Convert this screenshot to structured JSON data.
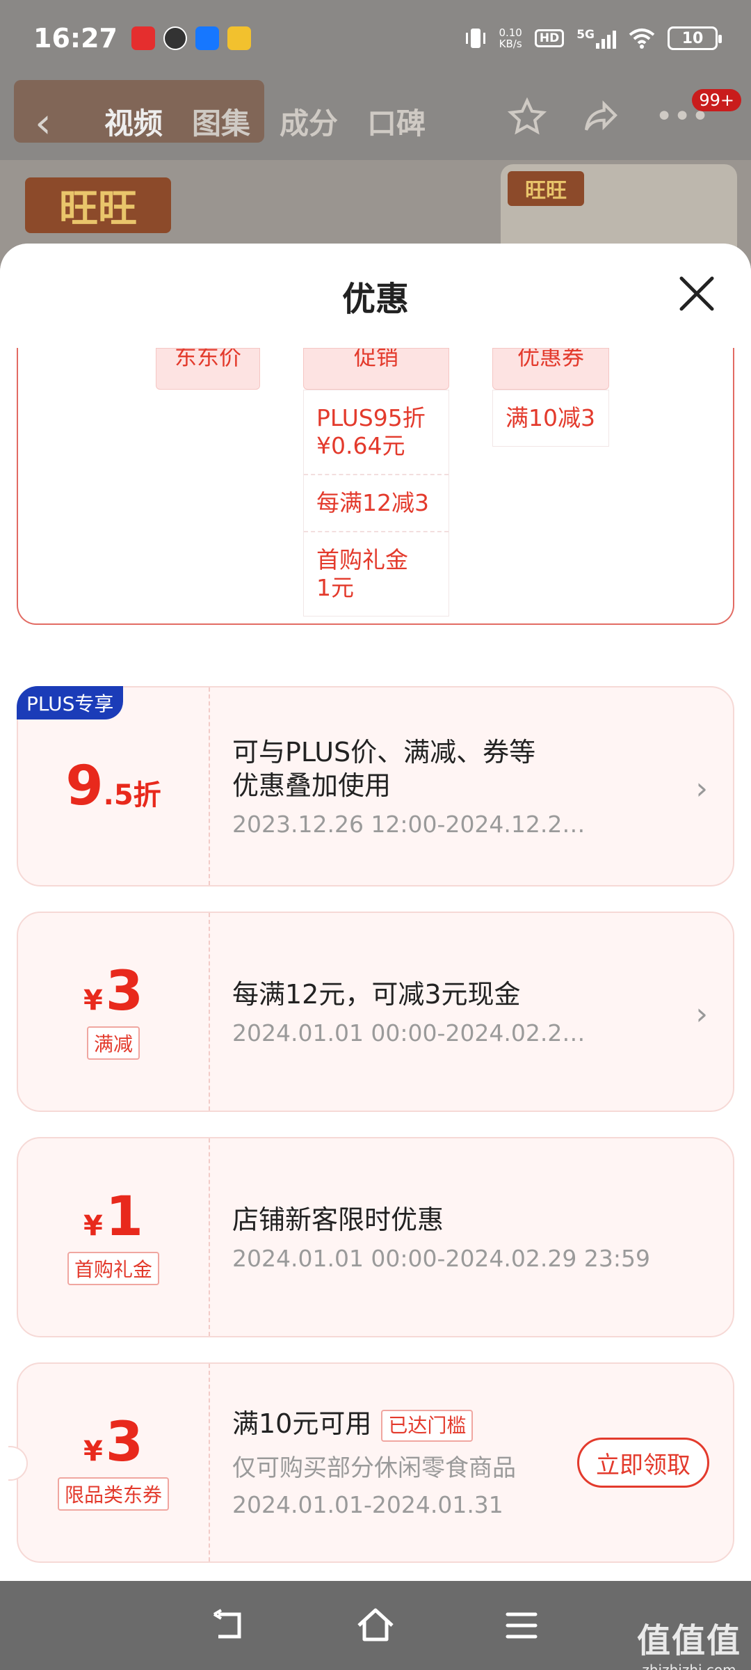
{
  "status_bar": {
    "time": "16:27",
    "net_speed_value": "0.10",
    "net_speed_unit": "KB/s",
    "hd": "HD",
    "network": "5G",
    "battery": "10"
  },
  "nav": {
    "tabs": [
      "视频",
      "图集",
      "成分",
      "口碑"
    ],
    "badge": "99+"
  },
  "background": {
    "brand_logo": "旺旺"
  },
  "sheet": {
    "title": "优惠",
    "summary": {
      "col1_head": "东东价",
      "col2_head": "促销",
      "col3_head": "优惠券",
      "promotions": [
        "PLUS95折\n¥0.64元",
        "每满12减3",
        "首购礼金\n1元"
      ],
      "coupons": [
        "满10减3"
      ]
    },
    "cards": [
      {
        "badge": "PLUS专享",
        "amount": "9",
        "amount_suffix": ".5折",
        "title": "可与PLUS价、满减、券等\n优惠叠加使用",
        "date": "2023.12.26 12:00-2024.12.2…"
      },
      {
        "yen": "¥",
        "amount": "3",
        "tag": "满减",
        "title": "每满12元，可减3元现金",
        "date": "2024.01.01 00:00-2024.02.2…"
      },
      {
        "yen": "¥",
        "amount": "1",
        "tag": "首购礼金",
        "title": "店铺新客限时优惠",
        "date": "2024.01.01 00:00-2024.02.29 23:59"
      },
      {
        "yen": "¥",
        "amount": "3",
        "tag": "限品类东券",
        "title": "满10元可用",
        "reached": "已达门槛",
        "subtitle": "仅可购买部分休闲零食商品",
        "date": "2024.01.01-2024.01.31",
        "button": "立即领取"
      }
    ]
  },
  "watermark": {
    "logo": "值值值",
    "domain": "zhizhizhi.com"
  },
  "colors": {
    "accent_red": "#e33a2c",
    "plus_blue": "#1b3cb8",
    "card_bg": "#fff5f4"
  }
}
